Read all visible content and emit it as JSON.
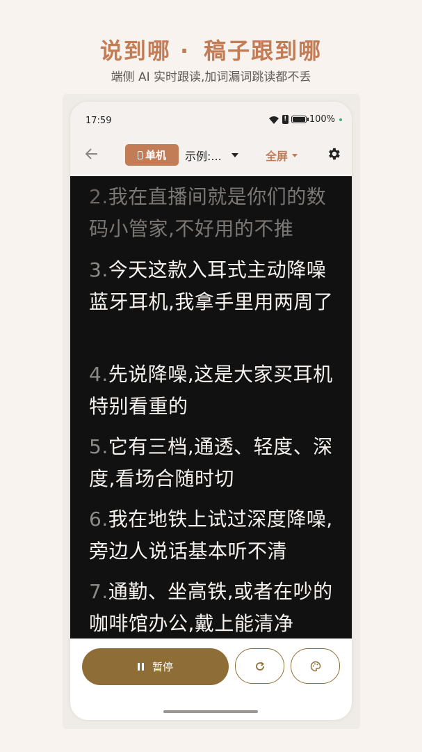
{
  "promo": {
    "headline_part1": "说到哪 ·",
    "headline_part2": "稿子跟到哪",
    "subline": "端侧 AI 实时跟读,加词漏词跳读都不丢"
  },
  "status_bar": {
    "time": "17:59",
    "alert": "!",
    "battery": "100%"
  },
  "toolbar": {
    "back_icon": "back-arrow-icon",
    "mode_label": "单机",
    "script_label": "示例:...",
    "fullscreen_label": "全屏",
    "settings_icon": "gear-icon"
  },
  "teleprompter": {
    "paragraphs": [
      {
        "num": "2.",
        "text": "我在直播间就是你们的数码小管家,不好用的不推"
      },
      {
        "num": "3.",
        "text": "今天这款入耳式主动降噪蓝牙耳机,我拿手里用两周了"
      },
      {
        "num": "4.",
        "text": "先说降噪,这是大家买耳机特别看重的"
      },
      {
        "num": "5.",
        "text": "它有三档,通透、轻度、深度,看场合随时切"
      },
      {
        "num": "6.",
        "text": "我在地铁上试过深度降噪,旁边人说话基本听不清"
      },
      {
        "num": "7.",
        "text": "通勤、坐高铁,或者在吵的咖啡馆办公,戴上能清净"
      }
    ]
  },
  "controls": {
    "pause_label": "暂停",
    "reset_icon": "refresh-icon",
    "theme_icon": "palette-icon"
  },
  "colors": {
    "accent": "#c27d57",
    "button": "#8e6e36",
    "reader_bg": "#111111"
  }
}
